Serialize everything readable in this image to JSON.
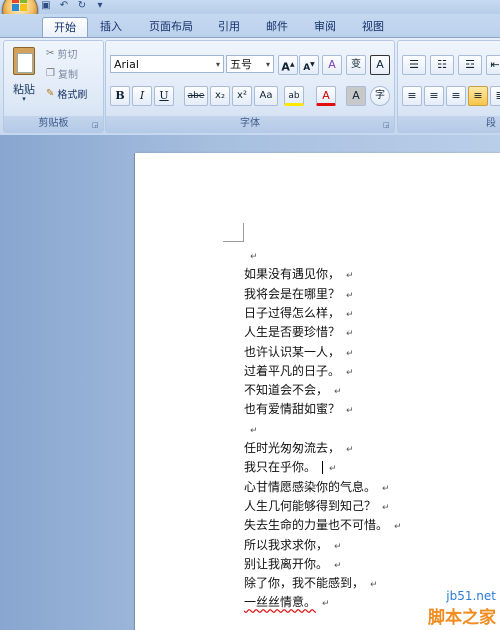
{
  "tabs": [
    "开始",
    "插入",
    "页面布局",
    "引用",
    "邮件",
    "审阅",
    "视图"
  ],
  "clipboard": {
    "paste_label": "粘贴",
    "cut_label": "剪切",
    "copy_label": "复制",
    "format_painter_label": "格式刷",
    "group_label": "剪贴板"
  },
  "font": {
    "font_name": "Arial",
    "font_size": "五号",
    "grow_glyph": "A",
    "shrink_glyph": "A",
    "clear_glyph": "A",
    "phonetic_glyph": "变",
    "border_glyph": "A",
    "bold": "B",
    "italic": "I",
    "underline": "U",
    "strike": "abe",
    "subscript": "x₂",
    "superscript": "x²",
    "case": "Aa",
    "highlight_glyph": "ab",
    "color_glyph": "A",
    "shade_glyph": "A",
    "enclose_glyph": "字",
    "group_label": "字体"
  },
  "paragraph": {
    "group_label": "段"
  },
  "document": {
    "lines": [
      "",
      "如果没有遇见你，",
      "我将会是在哪里？",
      "日子过得怎么样，",
      "人生是否要珍惜？",
      "也许认识某一人，",
      "过着平凡的日子。",
      "不知道会不会，",
      "也有爱情甜如蜜？",
      "",
      "任时光匆匆流去，",
      "我只在乎你。",
      "心甘情愿感染你的气息。",
      "人生几何能够得到知己？",
      "失去生命的力量也不可惜。",
      "所以我求求你，",
      "别让我离开你。",
      "除了你，我不能感到，",
      "一丝丝情意。"
    ],
    "paragraph_mark": "↵"
  },
  "watermark": {
    "url": "jb51.net",
    "brand": "脚本之家"
  },
  "colors": {
    "accent": "#15316a",
    "highlight": "#ffe800",
    "font_color": "#e01010"
  }
}
